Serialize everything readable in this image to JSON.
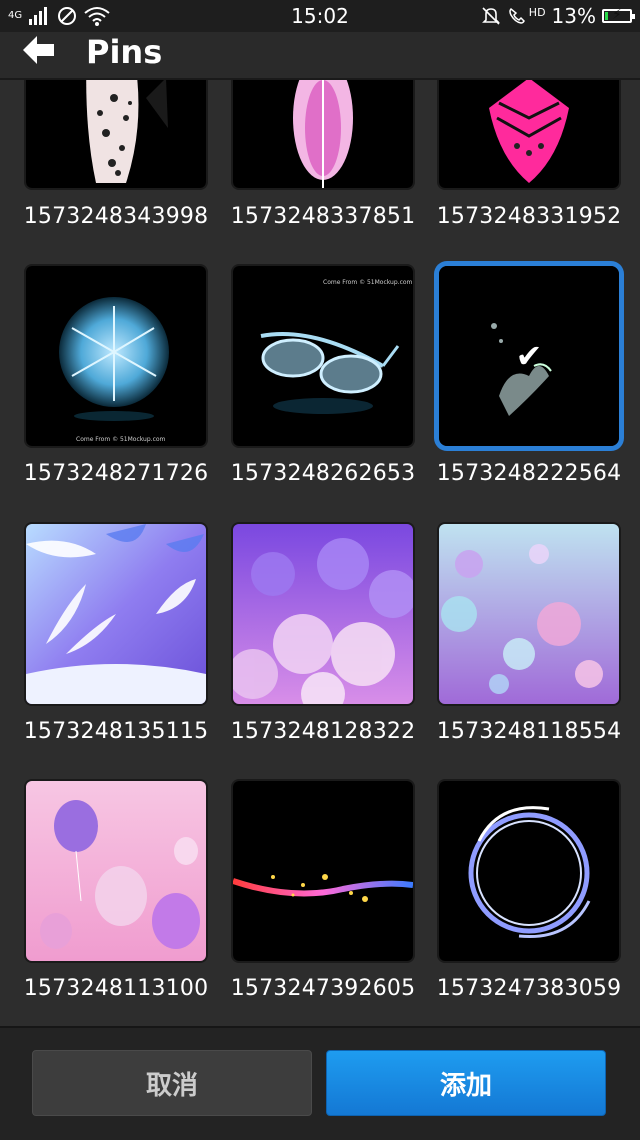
{
  "status_bar": {
    "network": "4G",
    "time": "15:02",
    "hd_label": "HD",
    "battery_percent": "13%",
    "battery_level": 0.13
  },
  "header": {
    "back_icon": "back-arrow-icon",
    "title": "Pins"
  },
  "grid": {
    "items": [
      {
        "caption": "1573248343998",
        "thumb": "feather-white-dots"
      },
      {
        "caption": "1573248337851",
        "thumb": "feather-pink"
      },
      {
        "caption": "1573248331952",
        "thumb": "feather-magenta"
      },
      {
        "caption": "1573248271726",
        "thumb": "water-splash-circle",
        "img_text": "Come From © 51Mockup.com"
      },
      {
        "caption": "1573248262653",
        "thumb": "water-glasses",
        "img_text": "Come From © 51Mockup.com"
      },
      {
        "caption": "1573248222564",
        "thumb": "water-splash-dark",
        "selected": true
      },
      {
        "caption": "1573248135115",
        "thumb": "purple-leaves"
      },
      {
        "caption": "1573248128322",
        "thumb": "purple-balloons"
      },
      {
        "caption": "1573248118554",
        "thumb": "bubbles"
      },
      {
        "caption": "1573248113100",
        "thumb": "pink-balloons"
      },
      {
        "caption": "1573247392605",
        "thumb": "light-streak"
      },
      {
        "caption": "1573247383059",
        "thumb": "light-ring"
      }
    ]
  },
  "footer": {
    "cancel_label": "取消",
    "add_label": "添加"
  },
  "colors": {
    "selection": "#2b7fd6",
    "add_button": "#1e9cf0",
    "battery": "#2ad84a"
  }
}
